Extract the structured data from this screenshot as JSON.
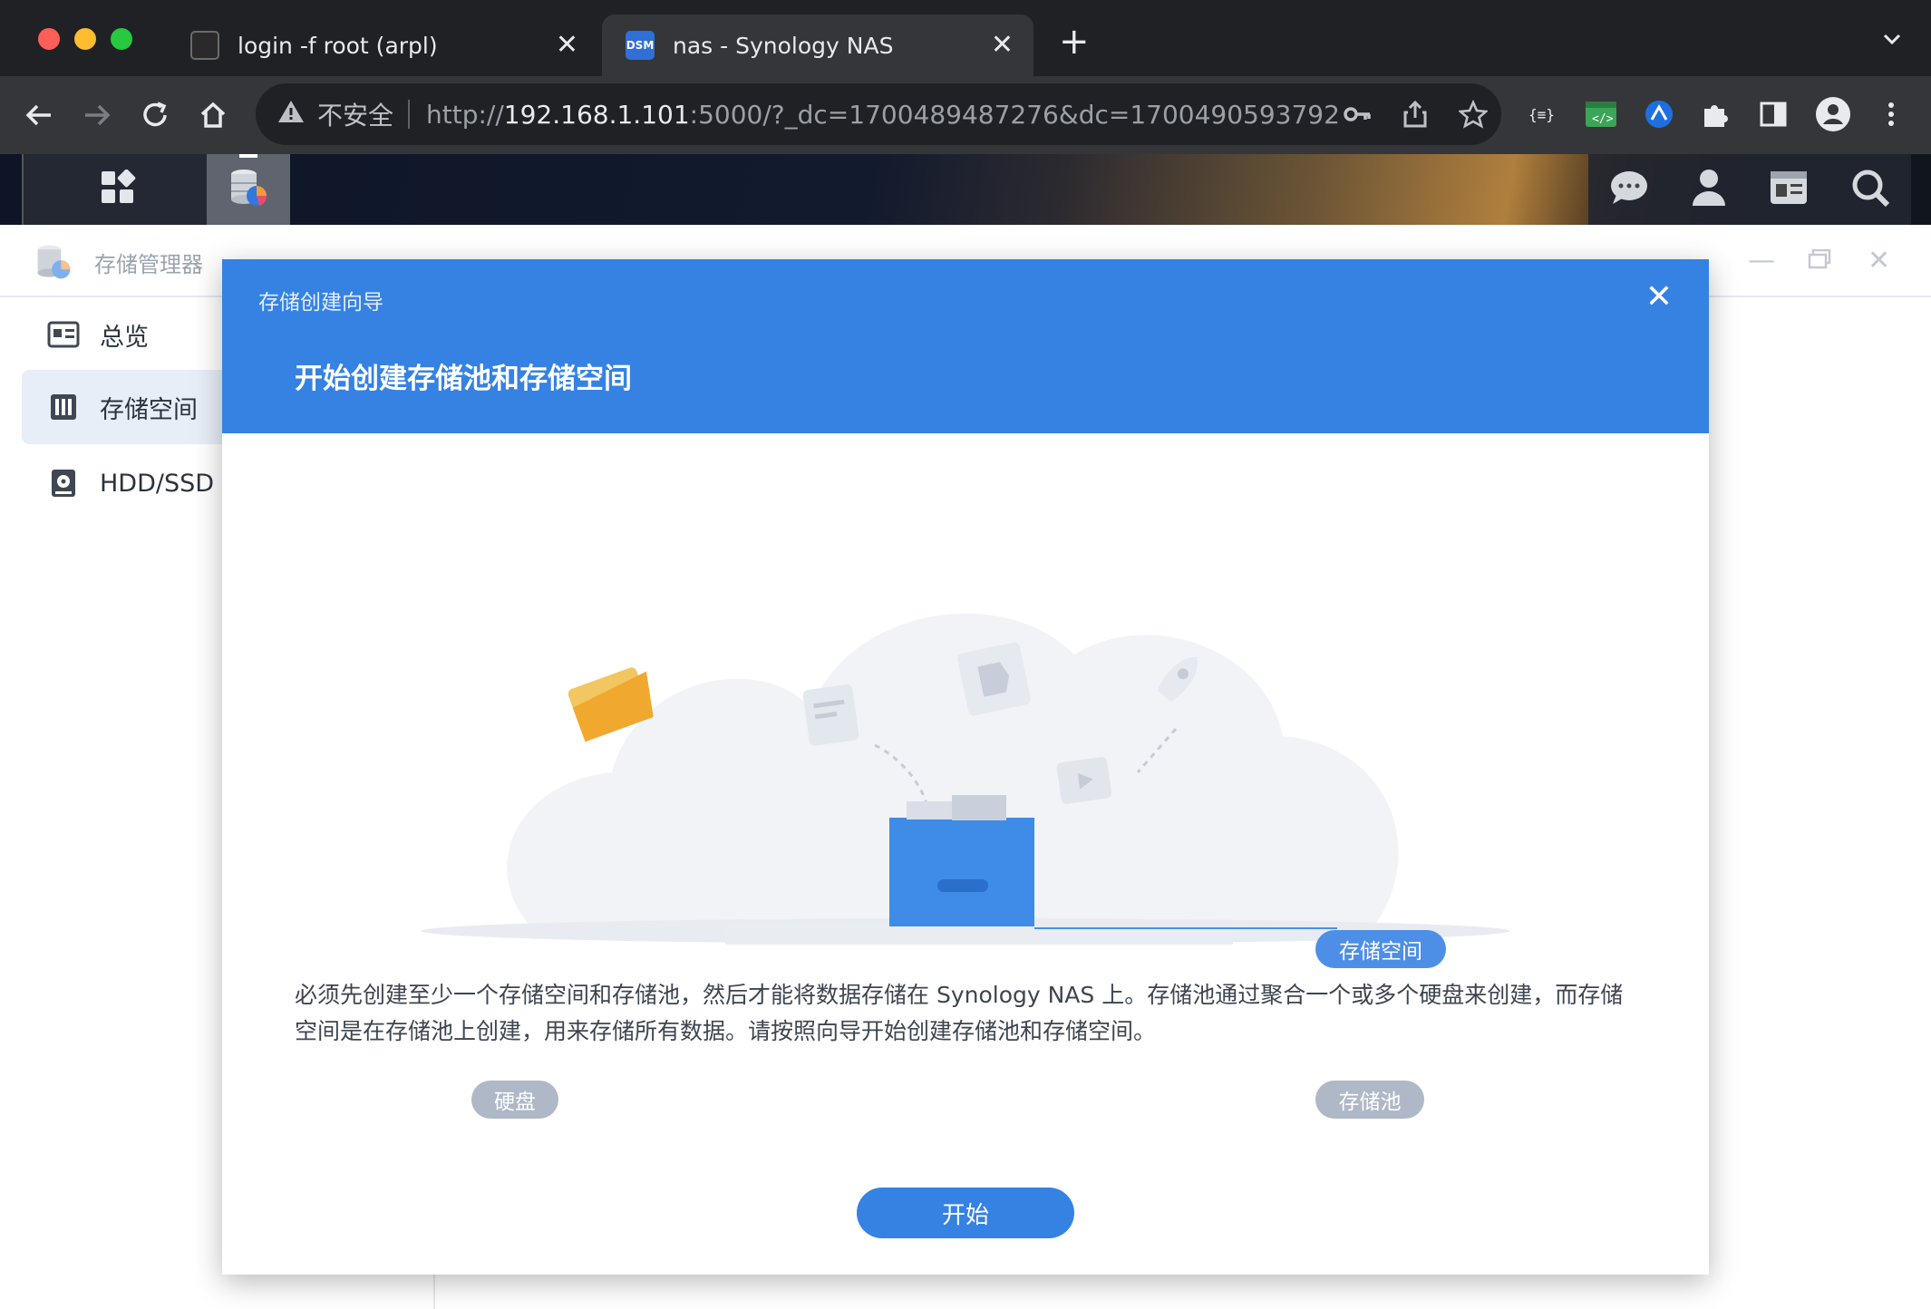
{
  "browser": {
    "tabs": [
      {
        "title": "login -f root (arpl)",
        "active": false
      },
      {
        "title": "nas - Synology NAS",
        "active": true,
        "favicon_text": "DSM"
      }
    ],
    "omnibox": {
      "security_label": "不安全",
      "url_scheme": "http://",
      "url_host": "192.168.1.101",
      "url_rest": ":5000/?_dc=1700489487276&dc=1700490593792"
    }
  },
  "app": {
    "title": "存储管理器",
    "sidebar": [
      {
        "label": "总览",
        "icon": "overview-icon"
      },
      {
        "label": "存储空间",
        "icon": "volume-icon",
        "selected": true
      },
      {
        "label": "HDD/SSD",
        "icon": "hdd-icon"
      }
    ]
  },
  "modal": {
    "subtitle": "存储创建向导",
    "title": "开始创建存储池和存储空间",
    "labels": {
      "volume": "存储空间",
      "disk": "硬盘",
      "pool": "存储池"
    },
    "description": "必须先创建至少一个存储空间和存储池，然后才能将数据存储在 Synology NAS 上。存储池通过聚合一个或多个硬盘来创建，而存储空间是在存储池上创建，用来存储所有数据。请按照向导开始创建存储池和存储空间。",
    "start_label": "开始"
  },
  "colors": {
    "accent": "#3582e3",
    "chrome_dark": "#202124",
    "chrome_mid": "#35363a"
  }
}
